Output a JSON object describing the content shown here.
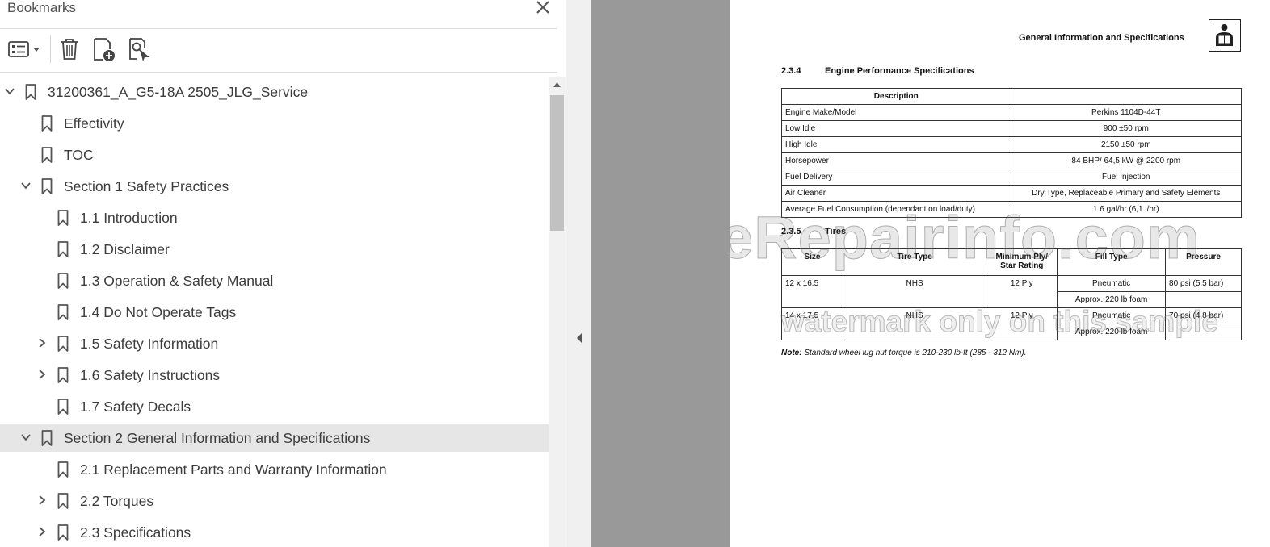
{
  "panel": {
    "title": "Bookmarks",
    "toolbar": {
      "options_icon": "list-options-icon",
      "delete_icon": "trash-icon",
      "new_bookmark_icon": "add-bookmark-icon",
      "find_bookmark_icon": "find-bookmark-icon"
    },
    "tree": [
      {
        "label": "31200361_A_G5-18A 2505_JLG_Service",
        "level": 0,
        "expander": "open",
        "selected": false
      },
      {
        "label": "Effectivity",
        "level": 1,
        "expander": "none",
        "selected": false
      },
      {
        "label": "TOC",
        "level": 1,
        "expander": "none",
        "selected": false
      },
      {
        "label": "Section 1 Safety Practices",
        "level": 1,
        "expander": "open",
        "selected": false
      },
      {
        "label": "1.1 Introduction",
        "level": 2,
        "expander": "none",
        "selected": false
      },
      {
        "label": "1.2 Disclaimer",
        "level": 2,
        "expander": "none",
        "selected": false
      },
      {
        "label": "1.3 Operation & Safety Manual",
        "level": 2,
        "expander": "none",
        "selected": false
      },
      {
        "label": "1.4 Do Not Operate Tags",
        "level": 2,
        "expander": "none",
        "selected": false
      },
      {
        "label": "1.5 Safety Information",
        "level": 2,
        "expander": "closed",
        "selected": false
      },
      {
        "label": "1.6 Safety Instructions",
        "level": 2,
        "expander": "closed",
        "selected": false
      },
      {
        "label": "1.7 Safety Decals",
        "level": 2,
        "expander": "none",
        "selected": false
      },
      {
        "label": "Section 2 General Information and Specifications",
        "level": 1,
        "expander": "open",
        "selected": true
      },
      {
        "label": "2.1 Replacement Parts and Warranty Information",
        "level": 2,
        "expander": "none",
        "selected": false
      },
      {
        "label": "2.2 Torques",
        "level": 2,
        "expander": "closed",
        "selected": false
      },
      {
        "label": "2.3 Specifications",
        "level": 2,
        "expander": "closed",
        "selected": false
      }
    ]
  },
  "document": {
    "header_title": "General Information and Specifications",
    "header_icon": "service-manual-icon",
    "section_engine": {
      "number": "2.3.4",
      "title": "Engine Performance Specifications",
      "col_description": "Description",
      "col_value": "",
      "rows": [
        {
          "label": "Engine Make/Model",
          "value": "Perkins 1104D-44T"
        },
        {
          "label": "Low Idle",
          "value": "900 ±50 rpm"
        },
        {
          "label": "High Idle",
          "value": "2150 ±50 rpm"
        },
        {
          "label": "Horsepower",
          "value": "84 BHP/ 64,5 kW @ 2200 rpm"
        },
        {
          "label": "Fuel Delivery",
          "value": "Fuel Injection"
        },
        {
          "label": "Air Cleaner",
          "value": "Dry Type, Replaceable Primary and Safety Elements"
        },
        {
          "label": "Average Fuel Consumption (dependant on load/duty)",
          "value": "1.6 gal/hr (6,1 l/hr)"
        }
      ]
    },
    "section_tires": {
      "number": "2.3.5",
      "title": "Tires",
      "headers": {
        "size": "Size",
        "tire_type": "Tire Type",
        "ply_line1": "Minimum Ply/",
        "ply_line2": "Star Rating",
        "fill_type": "Fill Type",
        "pressure": "Pressure"
      },
      "rows": [
        {
          "size": "12 x 16.5",
          "tire_type": "NHS",
          "ply": "12 Ply",
          "fill_primary": "Pneumatic",
          "pressure": "80 psi (5,5 bar)",
          "fill_alt": "Approx. 220 lb foam"
        },
        {
          "size": "14 x 17.5",
          "tire_type": "NHS",
          "ply": "12 Ply",
          "fill_primary": "Pneumatic",
          "pressure": "70 psi (4,8 bar)",
          "fill_alt": "Approx. 220 lb foam"
        }
      ]
    },
    "note_label": "Note:",
    "note_text": "Standard wheel lug nut torque is 210-230 lb-ft (285 - 312 Nm).",
    "watermark_main": "eRepairinfo.com",
    "watermark_sub": "watermark only on this sample"
  }
}
